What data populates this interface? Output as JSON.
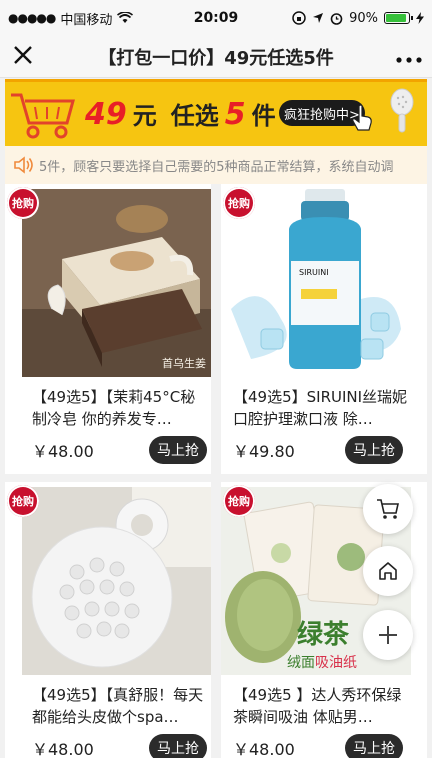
{
  "status_bar": {
    "carrier": "中国移动",
    "time": "20:09",
    "battery": "90%",
    "battery_level": 0.9
  },
  "nav": {
    "title": "【打包一口价】49元任选5件"
  },
  "banner": {
    "price_num": "49",
    "price_unit": "元",
    "pick_text": "任选",
    "count_num": "5",
    "count_unit": "件",
    "rush_button": "疯狂抢购中>"
  },
  "notice": {
    "text": "5件，顾客只要选择自己需要的5种商品正常结算，系统自动调"
  },
  "colors": {
    "banner_bg": "#f6c511",
    "accent_red": "#e81f27",
    "badge_red": "#c8102e",
    "button_dark": "#2b2b2b"
  },
  "products": [
    {
      "badge": "抢购",
      "name": "【49选5】【茉莉45°C秘制冷皂 你的养发专…",
      "price": "￥48.00",
      "buy": "马上抢",
      "image_caption": "首乌生姜"
    },
    {
      "badge": "抢购",
      "name": "【49选5】SIRUINI丝瑞妮口腔护理漱口液 除…",
      "price": "￥49.80",
      "buy": "马上抢",
      "image_caption": "SIRUINI"
    },
    {
      "badge": "抢购",
      "name": "【49选5】【真舒服！每天都能给头皮做个spa…",
      "price": "￥48.00",
      "buy": "马上抢",
      "image_caption": ""
    },
    {
      "badge": "抢购",
      "name": "【49选5 】达人秀环保绿茶瞬间吸油 体贴男…",
      "price": "￥48.00",
      "buy": "马上抢",
      "image_caption": "绿茶"
    }
  ],
  "floating_buttons": [
    "cart-icon",
    "home-icon",
    "plus-icon"
  ]
}
